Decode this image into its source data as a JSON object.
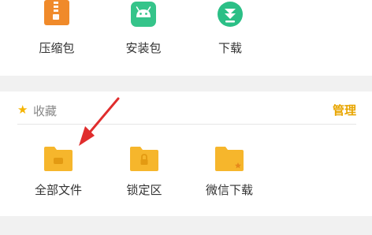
{
  "top_row": {
    "items": [
      {
        "label": "压缩包",
        "icon": "zip-icon"
      },
      {
        "label": "安装包",
        "icon": "android-icon"
      },
      {
        "label": "下载",
        "icon": "download-icon"
      }
    ]
  },
  "favorites": {
    "title": "收藏",
    "manage_label": "管理",
    "items": [
      {
        "label": "全部文件",
        "icon": "folder-files-icon"
      },
      {
        "label": "锁定区",
        "icon": "folder-lock-icon"
      },
      {
        "label": "微信下载",
        "icon": "folder-star-icon"
      }
    ]
  },
  "colors": {
    "accent": "#e8a500",
    "folder": "#f6b62c",
    "android": "#35c48a",
    "download": "#2bbf86",
    "zip": "#f08a2a",
    "annotation_arrow": "#e02d2d"
  }
}
